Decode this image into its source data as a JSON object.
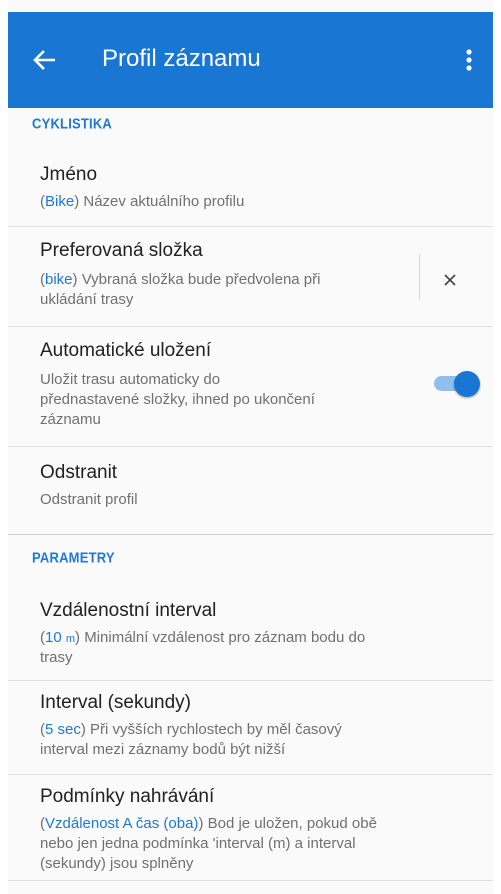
{
  "header": {
    "title": "Profil záznamu"
  },
  "sections": {
    "cycling": "CYKLISTIKA",
    "params": "PARAMETRY"
  },
  "items": {
    "name": {
      "title": "Jméno",
      "value": "Bike",
      "desc": "Název aktuálního profilu"
    },
    "folder": {
      "title": "Preferovaná složka",
      "value": "bike",
      "desc_line1": "Vybraná složka bude předvolena při",
      "desc_line2": "ukládání trasy"
    },
    "autosave": {
      "title": "Automatické uložení",
      "desc_line1": "Uložit trasu automaticky do",
      "desc_line2": "přednastavené složky, ihned po ukončení",
      "desc_line3": "záznamu",
      "enabled": true
    },
    "remove": {
      "title": "Odstranit",
      "desc": "Odstranit profil"
    },
    "distance": {
      "title": "Vzdálenostní interval",
      "value": "10",
      "unit": "m",
      "desc_line1": "Minimální vzdálenost pro záznam bodu do",
      "desc_line2": "trasy"
    },
    "interval": {
      "title": "Interval (sekundy)",
      "value": "5 sec",
      "desc_line1": "Při vyšších rychlostech by měl časový",
      "desc_line2": "interval mezi záznamy bodů být nižší"
    },
    "conditions": {
      "title": "Podmínky nahrávání",
      "value": "Vzdálenost A čas (oba)",
      "desc_line1": "Bod je uložen, pokud obě",
      "desc_line2": "nebo jen jedna podmínka 'interval (m) a interval",
      "desc_line3": "(sekundy) jsou splněny"
    }
  },
  "colors": {
    "primary": "#1976d2",
    "accent": "#1e78d4",
    "toggle_track": "#90bfee"
  },
  "icons": {
    "back": "arrow-back-icon",
    "menu": "more-vert-icon",
    "clear": "close-icon"
  }
}
